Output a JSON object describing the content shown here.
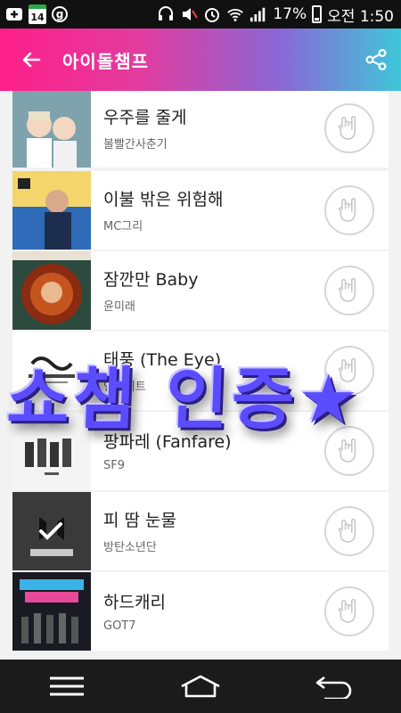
{
  "status_bar": {
    "calendar_day": "14",
    "g_badge": "g",
    "battery": "17%",
    "time": "오전 1:50",
    "icons": [
      "add-icon",
      "calendar-icon",
      "g-icon",
      "headset-icon",
      "mute-icon",
      "alarm-icon",
      "wifi-icon",
      "signal-icon",
      "battery-icon"
    ]
  },
  "header": {
    "title": "아이돌챔프",
    "back_icon": "arrow-left-icon",
    "share_icon": "share-icon",
    "accent_colors": [
      "#ff1f8a",
      "#8a67d6",
      "#3fc7d8"
    ]
  },
  "songs": [
    {
      "title": "우주를 줄게",
      "artist": "볼빨간사춘기",
      "art_color": "#8fb3b8"
    },
    {
      "title": "이불 밖은 위험해",
      "artist": "MC그리",
      "art_color": "#f1d36a"
    },
    {
      "title": "잠깐만 Baby",
      "artist": "윤미래",
      "art_color": "#7a2612"
    },
    {
      "title": "태풍 (The Eye)",
      "artist": "인피니트",
      "art_color": "#ffffff"
    },
    {
      "title": "팡파레 (Fanfare)",
      "artist": "SF9",
      "art_color": "#f5f5f5"
    },
    {
      "title": "피 땀 눈물",
      "artist": "방탄소년단",
      "art_color": "#3a3a3a"
    },
    {
      "title": "하드캐리",
      "artist": "GOT7",
      "art_color": "#1a1a22"
    }
  ],
  "overlay_text": "쇼챔 인증★",
  "nav": {
    "icons": [
      "menu-icon",
      "home-icon",
      "back-icon"
    ]
  }
}
